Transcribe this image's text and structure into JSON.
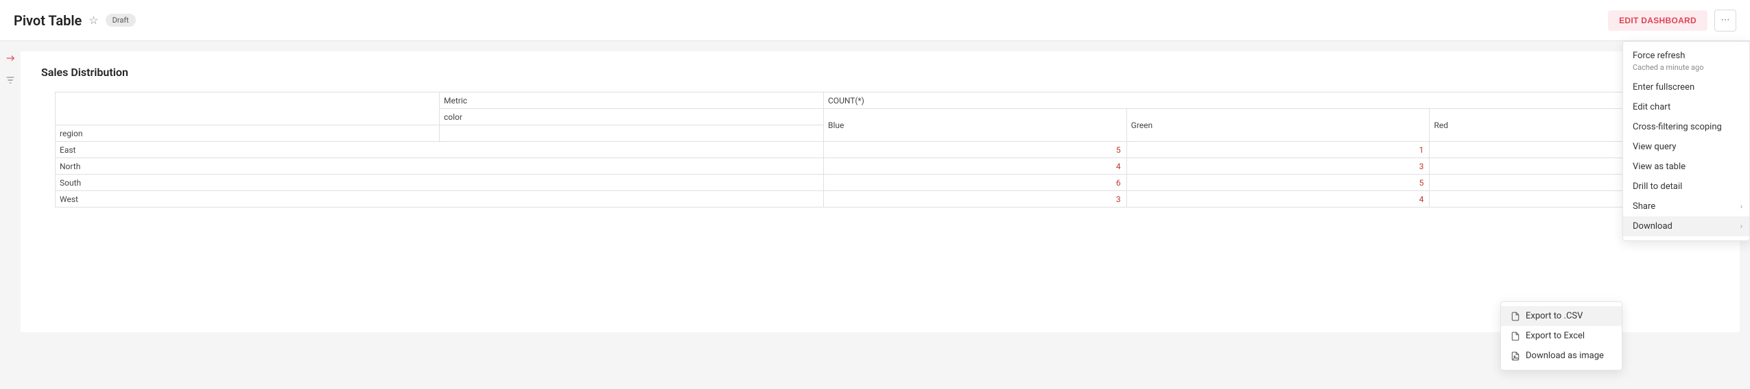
{
  "header": {
    "title": "Pivot Table",
    "badge": "Draft",
    "edit_button": "EDIT DASHBOARD"
  },
  "chart": {
    "title": "Sales Distribution",
    "metric_header": "Metric",
    "count_header": "COUNT(*)",
    "color_header": "color",
    "region_header": "region",
    "columns": [
      "Blue",
      "Green",
      "Red"
    ],
    "rows": [
      {
        "region": "East",
        "values": [
          "5",
          "1",
          ""
        ]
      },
      {
        "region": "North",
        "values": [
          "4",
          "3",
          ""
        ]
      },
      {
        "region": "South",
        "values": [
          "6",
          "5",
          ""
        ]
      },
      {
        "region": "West",
        "values": [
          "3",
          "4",
          ""
        ]
      }
    ]
  },
  "menu": {
    "force_refresh": "Force refresh",
    "cached": "Cached a minute ago",
    "enter_fullscreen": "Enter fullscreen",
    "edit_chart": "Edit chart",
    "cross_filtering": "Cross-filtering scoping",
    "view_query": "View query",
    "view_as_table": "View as table",
    "drill_to_detail": "Drill to detail",
    "share": "Share",
    "download": "Download"
  },
  "submenu": {
    "export_csv": "Export to .CSV",
    "export_excel": "Export to Excel",
    "download_image": "Download as image"
  }
}
